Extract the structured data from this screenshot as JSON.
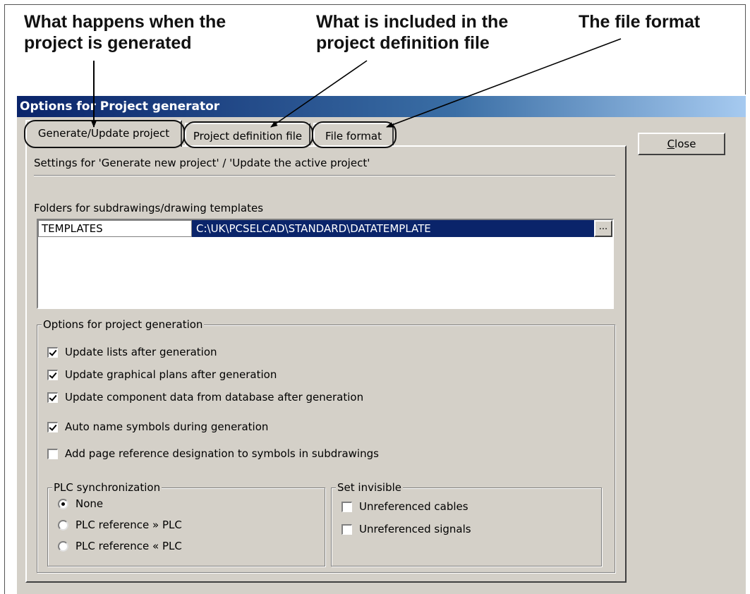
{
  "annotations": [
    {
      "text": "What happens when the\nproject is generated"
    },
    {
      "text": "What is included in the\nproject definition file"
    },
    {
      "text": "The file format"
    }
  ],
  "dialog": {
    "title": "Options for Project generator",
    "close_button": {
      "mnemonic": "C",
      "rest": "lose"
    },
    "tabs": [
      {
        "label": "Generate/Update project",
        "active": true
      },
      {
        "label": "Project definition file",
        "active": false
      },
      {
        "label": "File format",
        "active": false
      }
    ],
    "settings_caption": "Settings for 'Generate new project' / 'Update the active project'",
    "folders_label": "Folders for subdrawings/drawing templates",
    "folders": [
      {
        "key": "TEMPLATES",
        "path": "C:\\UK\\PCSELCAD\\STANDARD\\DATATEMPLATE",
        "browse": "..."
      }
    ],
    "generation_options": {
      "title": "Options for project generation",
      "items": [
        {
          "label": "Update lists after generation",
          "checked": true
        },
        {
          "label": "Update graphical plans after generation",
          "checked": true
        },
        {
          "label": "Update component data from database after generation",
          "checked": true
        },
        {
          "label": "Auto name symbols during generation",
          "checked": true
        },
        {
          "label": "Add page reference designation to symbols in subdrawings",
          "checked": false
        }
      ]
    },
    "plc_sync": {
      "title": "PLC synchronization",
      "options": [
        {
          "label": "None",
          "selected": true
        },
        {
          "label": "PLC reference » PLC",
          "selected": false
        },
        {
          "label": "PLC reference « PLC",
          "selected": false
        }
      ]
    },
    "set_invisible": {
      "title": "Set invisible",
      "items": [
        {
          "label": "Unreferenced cables",
          "checked": false
        },
        {
          "label": "Unreferenced signals",
          "checked": false
        }
      ]
    }
  }
}
